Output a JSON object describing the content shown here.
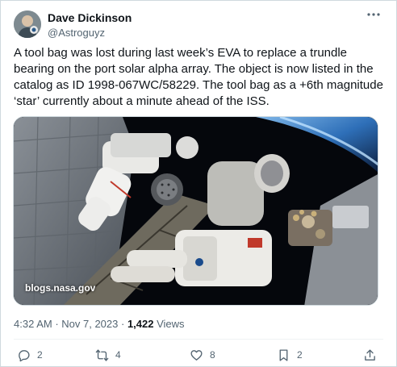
{
  "author": {
    "display_name": "Dave Dickinson",
    "handle": "@Astroguyz"
  },
  "tweet": {
    "text": "A tool bag was lost during last week’s EVA to replace a trundle bearing on the port solar alpha array. The object is now listed in the catalog as ID 1998-067WC/58229. The tool bag as a +6th magnitude ‘star’ currently about a minute ahead of the ISS."
  },
  "media": {
    "credit": "blogs.nasa.gov"
  },
  "meta": {
    "time": "4:32 AM",
    "sep1": " · ",
    "date": "Nov 7, 2023",
    "sep2": " · ",
    "views_count": "1,422",
    "views_label": " Views"
  },
  "actions": {
    "replies": "2",
    "reposts": "4",
    "likes": "8",
    "bookmarks": "2"
  },
  "colors": {
    "text_primary": "#0f1419",
    "text_secondary": "#536471",
    "border": "#cfd9de"
  },
  "icons": [
    "more-icon",
    "reply-icon",
    "retweet-icon",
    "like-icon",
    "bookmark-icon",
    "share-icon"
  ]
}
